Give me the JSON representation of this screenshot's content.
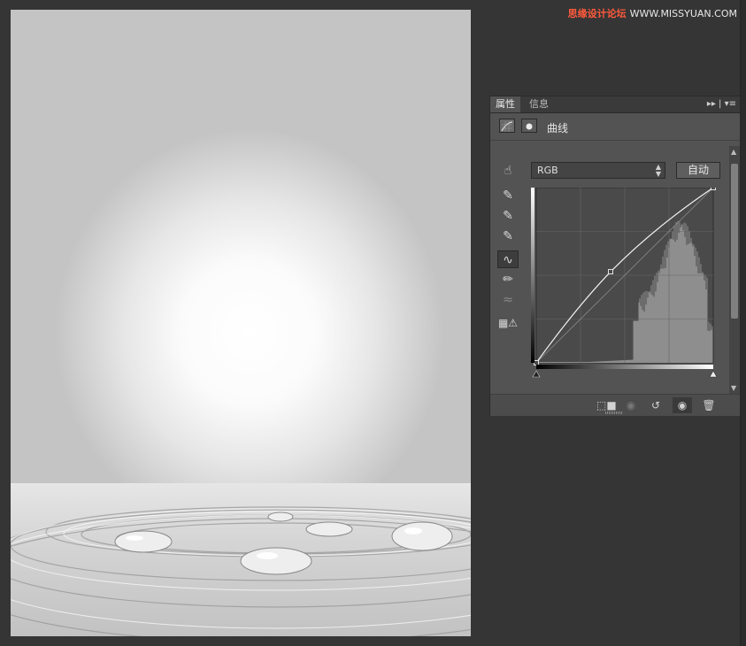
{
  "watermark": {
    "brand": "思缘设计论坛",
    "url": "WWW.MISSYUAN.COM"
  },
  "panel": {
    "tabs": [
      {
        "label": "属性"
      },
      {
        "label": "信息"
      }
    ],
    "tab_menu_glyphs": "▸▸ | ▾≡",
    "header_title": "曲线",
    "channel": {
      "value": "RGB"
    },
    "auto_label": "自动",
    "icons": {
      "tools": [
        "on-image-adjust-icon",
        "black-eyedropper-icon",
        "gray-eyedropper-icon",
        "white-eyedropper-icon",
        "curve-point-icon",
        "pencil-icon",
        "smooth-icon",
        "clipping-warning-icon"
      ],
      "bottom": [
        "clip-to-layer-icon",
        "view-previous-icon",
        "reset-icon",
        "visibility-icon",
        "delete-icon"
      ]
    }
  },
  "curve": {
    "points": [
      [
        0,
        0
      ],
      [
        0.42,
        0.52
      ],
      [
        1,
        1
      ]
    ],
    "histogram_color": "#8e8e8e"
  },
  "colors": {
    "panel": "#535353",
    "workspace": "#353535",
    "accent_watermark": "#ff5a3c"
  }
}
